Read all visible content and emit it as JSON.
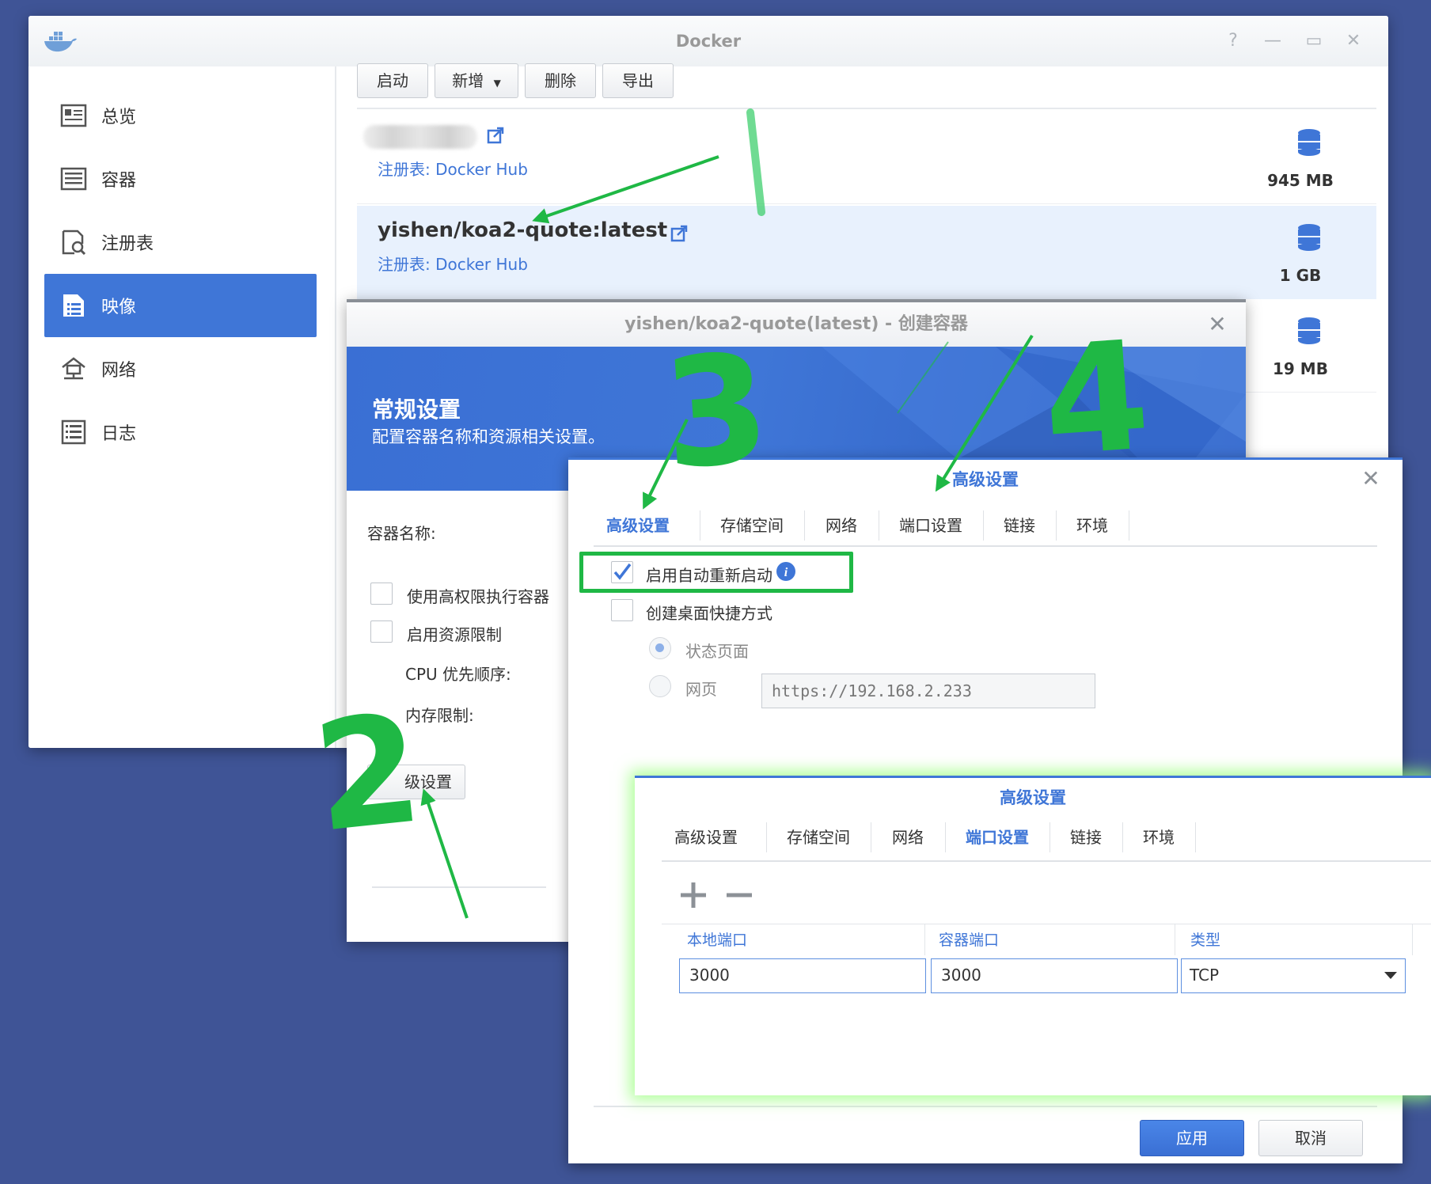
{
  "main_window": {
    "title": "Docker",
    "sidebar": {
      "items": [
        {
          "label": "总览",
          "icon": "overview-icon"
        },
        {
          "label": "容器",
          "icon": "container-icon"
        },
        {
          "label": "注册表",
          "icon": "registry-icon"
        },
        {
          "label": "映像",
          "icon": "image-icon",
          "active": true
        },
        {
          "label": "网络",
          "icon": "network-icon"
        },
        {
          "label": "日志",
          "icon": "log-icon"
        }
      ]
    },
    "toolbar": {
      "start": "启动",
      "add": "新增",
      "delete": "删除",
      "export": "导出"
    },
    "images": [
      {
        "name": "",
        "registry": "注册表: Docker Hub",
        "size": "945 MB"
      },
      {
        "name": "yishen/koa2-quote:latest",
        "registry": "注册表: Docker Hub",
        "size": "1 GB",
        "selected": true
      },
      {
        "name": "",
        "registry": "",
        "size": "19 MB"
      }
    ]
  },
  "create_dialog": {
    "title": "yishen/koa2-quote(latest) - 创建容器",
    "banner_title": "常规设置",
    "banner_subtitle": "配置容器名称和资源相关设置。",
    "container_name_label": "容器名称:",
    "privileged_label": "使用高权限执行容器",
    "resource_limit_label": "启用资源限制",
    "cpu_label": "CPU 优先顺序:",
    "memory_label": "内存限制:",
    "advanced_button": "级设置"
  },
  "advanced_dialog_1": {
    "title": "高级设置",
    "tabs": [
      "高级设置",
      "存储空间",
      "网络",
      "端口设置",
      "链接",
      "环境"
    ],
    "active_tab": "高级设置",
    "auto_restart_label": "启用自动重新启动",
    "auto_restart_checked": true,
    "shortcut_label": "创建桌面快捷方式",
    "status_page_label": "状态页面",
    "webpage_label": "网页",
    "url_value": "https://192.168.2.233",
    "apply": "应用",
    "cancel": "取消"
  },
  "advanced_dialog_2": {
    "title": "高级设置",
    "tabs": [
      "高级设置",
      "存储空间",
      "网络",
      "端口设置",
      "链接",
      "环境"
    ],
    "active_tab": "端口设置",
    "columns": [
      "本地端口",
      "容器端口",
      "类型"
    ],
    "row": {
      "local_port": "3000",
      "container_port": "3000",
      "type": "TCP"
    }
  },
  "annotations": {
    "numbers": [
      "2",
      "3",
      "4"
    ],
    "color": "#1fb845",
    "highlight_color": "#1fb845"
  }
}
